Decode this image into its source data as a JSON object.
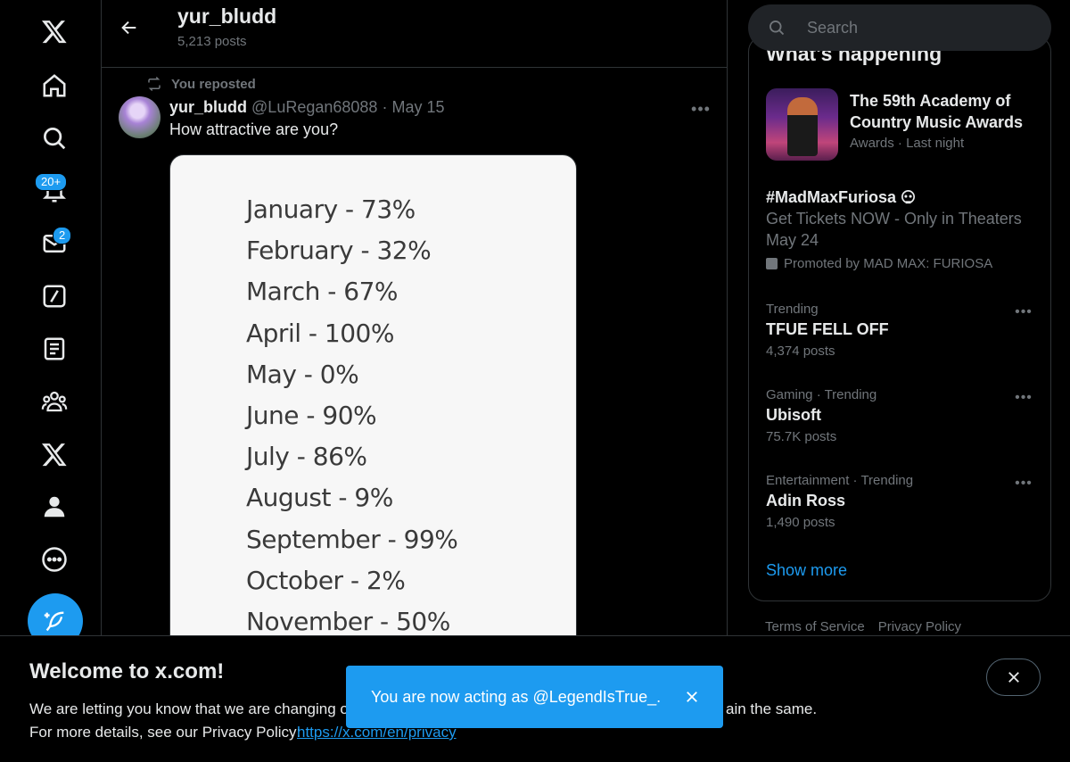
{
  "nav": {
    "items": [
      {
        "name": "x-logo-icon"
      },
      {
        "name": "home-icon"
      },
      {
        "name": "search-icon"
      },
      {
        "name": "notifications-icon",
        "badge": "20+"
      },
      {
        "name": "messages-icon",
        "badge": "2"
      },
      {
        "name": "grok-icon"
      },
      {
        "name": "lists-icon"
      },
      {
        "name": "communities-icon"
      },
      {
        "name": "premium-icon"
      },
      {
        "name": "profile-icon"
      },
      {
        "name": "more-icon"
      }
    ],
    "compose": "compose-icon"
  },
  "header": {
    "name": "yur_bludd",
    "posts": "5,213 posts"
  },
  "tweet": {
    "repost_label": "You reposted",
    "author_name": "yur_bludd",
    "handle": "@LuRegan68088",
    "separator": "·",
    "date": "May 15",
    "text": "How attractive are you?",
    "image_lines": [
      "January - 73%",
      "February - 32%",
      "March - 67%",
      "April - 100%",
      "May - 0%",
      "June - 90%",
      "July - 86%",
      "August - 9%",
      "September - 99%",
      "October - 2%",
      "November - 50%"
    ]
  },
  "search": {
    "placeholder": "Search"
  },
  "trends": {
    "title": "What's happening",
    "event": {
      "title": "The 59th Academy of Country Music Awards",
      "meta": "Awards · Last night"
    },
    "promoted": {
      "title": "#MadMaxFuriosa",
      "description": "Get Tickets NOW - Only in Theaters May 24",
      "promoted_by": "Promoted by MAD MAX: FURIOSA"
    },
    "items": [
      {
        "meta": "Trending",
        "title": "TFUE FELL OFF",
        "count": "4,374 posts"
      },
      {
        "meta": "Gaming · Trending",
        "title": "Ubisoft",
        "count": "75.7K posts"
      },
      {
        "meta": "Entertainment · Trending",
        "title": "Adin Ross",
        "count": "1,490 posts"
      }
    ],
    "show_more": "Show more"
  },
  "footer": {
    "terms": "Terms of Service",
    "privacy": "Privacy Policy"
  },
  "banner": {
    "title": "Welcome to x.com!",
    "line1": "We are letting you know that we are changing ou",
    "line1_tail": "ain the same.",
    "line2": "For more details, see our Privacy Policy:",
    "link": "https://x.com/en/privacy"
  },
  "toast": {
    "text": "You are now acting as @LegendIsTrue_."
  },
  "colors": {
    "accent": "#1d9bf0",
    "background": "#000000",
    "muted": "#71767b",
    "text": "#e7e9ea"
  }
}
